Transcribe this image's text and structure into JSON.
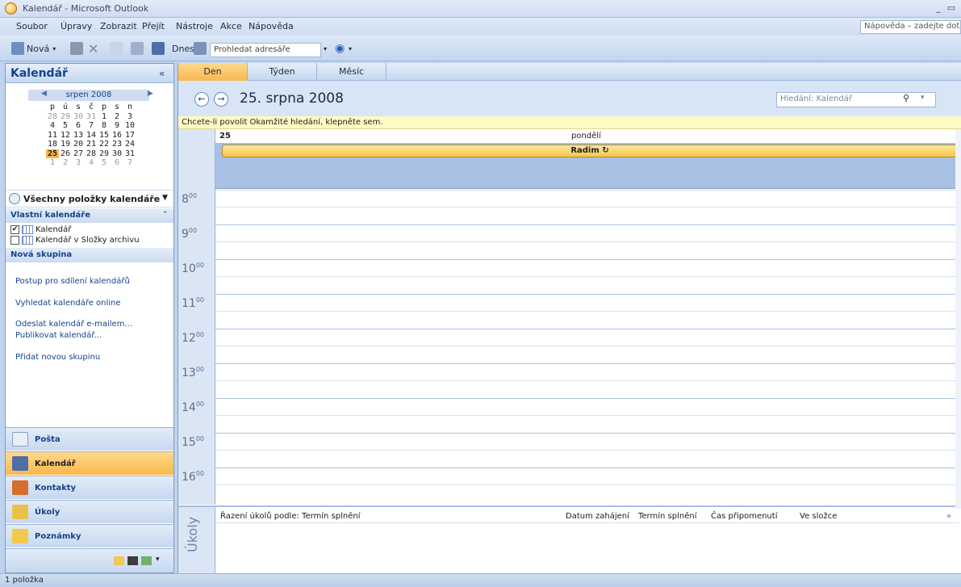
{
  "window": {
    "title": "Kalendář - Microsoft Outlook",
    "min": "_",
    "restore": "▭"
  },
  "menu": [
    "Soubor",
    "Úpravy",
    "Zobrazit",
    "Přejít",
    "Nástroje",
    "Akce",
    "Nápověda"
  ],
  "help_box": "Nápověda – zadejte dotaz",
  "toolbar": {
    "new_label": "Nová",
    "today_label": "Dnes",
    "address_placeholder": "Prohledat adresáře"
  },
  "nav": {
    "title": "Kalendář",
    "collapse": "«",
    "minical": {
      "month": "srpen 2008",
      "weekdays": [
        "p",
        "ú",
        "s",
        "č",
        "p",
        "s",
        "n"
      ],
      "weeks": [
        [
          "28",
          "29",
          "30",
          "31",
          "1",
          "2",
          "3"
        ],
        [
          "4",
          "5",
          "6",
          "7",
          "8",
          "9",
          "10"
        ],
        [
          "11",
          "12",
          "13",
          "14",
          "15",
          "16",
          "17"
        ],
        [
          "18",
          "19",
          "20",
          "21",
          "22",
          "23",
          "24"
        ],
        [
          "25",
          "26",
          "27",
          "28",
          "29",
          "30",
          "31"
        ],
        [
          "1",
          "2",
          "3",
          "4",
          "5",
          "6",
          "7"
        ]
      ]
    },
    "all_items": "Všechny položky kalendáře",
    "my_calendars_head": "Vlastní kalendáře",
    "calendars": [
      {
        "label": "Kalendář",
        "checked": "✔"
      },
      {
        "label": "Kalendář v Složky archivu",
        "checked": ""
      }
    ],
    "new_group_head": "Nová skupina",
    "links": [
      "Postup pro sdílení kalendářů",
      "Vyhledat kalendáře online",
      "Odeslat kalendář e-mailem...",
      "Publikovat kalendář...",
      "Přidat novou skupinu"
    ],
    "buttons": [
      "Pošta",
      "Kalendář",
      "Kontakty",
      "Úkoly",
      "Poznámky"
    ]
  },
  "main": {
    "tabs": [
      "Den",
      "Týden",
      "Měsíc"
    ],
    "date_title": "25. srpna 2008",
    "search_placeholder": "Hledání: Kalendář",
    "info_bar": "Chcete-li povolit Okamžité hledání, klepněte sem.",
    "day_number": "25",
    "weekday": "pondělí",
    "event": "Radim ↻",
    "hours": [
      "8",
      "9",
      "10",
      "11",
      "12",
      "13",
      "14",
      "15",
      "16"
    ],
    "minutes": "00"
  },
  "tasks": {
    "side_label": "Úkoly",
    "sort_label": "Řazení úkolů podle: Termín splnění",
    "columns": [
      "Datum zahájení",
      "Termín splnění",
      "Čas připomenutí",
      "Ve složce"
    ]
  },
  "status": "1 položka",
  "colors": {
    "accent": "#f9b84d",
    "nav_bg": "#c5d8f0",
    "brand_text": "#15428b"
  }
}
